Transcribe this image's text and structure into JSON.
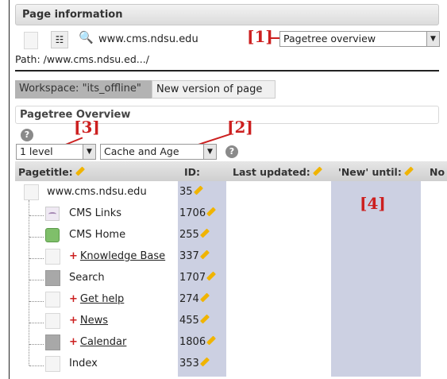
{
  "page_info": {
    "title": "Page information",
    "site_url": "www.cms.ndsu.edu",
    "path": "Path: /www.cms.ndsu.ed.../",
    "module_select": "Pagetree overview"
  },
  "callouts": {
    "c1": "[1]",
    "c2": "[2]",
    "c3": "[3]",
    "c4": "[4]"
  },
  "tabs": {
    "workspace": "Workspace: \"its_offline\"",
    "new_version": "New version of page"
  },
  "section": {
    "title": "Pagetree Overview"
  },
  "filters": {
    "depth": "1 level",
    "info": "Cache and Age"
  },
  "table": {
    "headers": {
      "pagetitle": "Pagetitle:",
      "id": "ID:",
      "last_updated": "Last updated:",
      "new_until": "'New' until:",
      "more": "No"
    },
    "rows": [
      {
        "title": "www.cms.ndsu.edu",
        "id": "35",
        "plus": "",
        "linked": false
      },
      {
        "title": "CMS Links",
        "id": "1706",
        "plus": "",
        "linked": false
      },
      {
        "title": "CMS Home",
        "id": "255",
        "plus": "",
        "linked": false
      },
      {
        "title": "Knowledge Base",
        "id": "337",
        "plus": "+",
        "linked": true
      },
      {
        "title": "Search",
        "id": "1707",
        "plus": "",
        "linked": false
      },
      {
        "title": "Get help",
        "id": "274",
        "plus": "+",
        "linked": true
      },
      {
        "title": "News",
        "id": "455",
        "plus": "+",
        "linked": true
      },
      {
        "title": "Calendar",
        "id": "1806",
        "plus": "+",
        "linked": true
      },
      {
        "title": "Index",
        "id": "353",
        "plus": "",
        "linked": false
      }
    ]
  },
  "colors": {
    "callout_red": "#cc1f1f",
    "column_highlight": "#ccd0e2",
    "workspace_tab": "#b3b3b3"
  }
}
